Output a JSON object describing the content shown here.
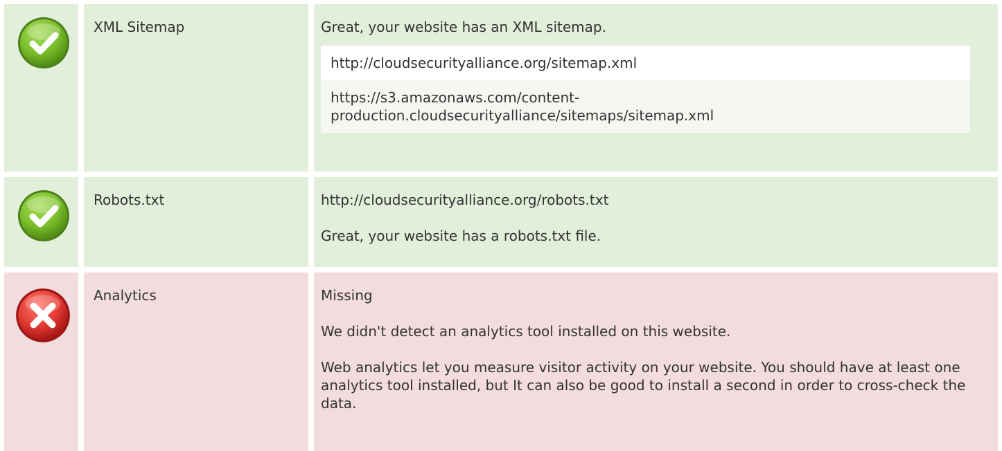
{
  "rows": [
    {
      "status": "pass",
      "icon": "check-icon",
      "label": "XML Sitemap",
      "message": "Great, your website has an XML sitemap.",
      "urls": [
        "http://cloudsecurityalliance.org/sitemap.xml",
        "https://s3.amazonaws.com/content-production.cloudsecurityalliance/sitemaps/sitemap.xml"
      ]
    },
    {
      "status": "pass",
      "icon": "check-icon",
      "label": "Robots.txt",
      "url": "http://cloudsecurityalliance.org/robots.txt",
      "message": "Great, your website has a robots.txt file."
    },
    {
      "status": "fail",
      "icon": "cross-icon",
      "label": "Analytics",
      "value": "Missing",
      "message": "We didn't detect an analytics tool installed on this website.",
      "advice": "Web analytics let you measure visitor activity on your website. You should have at least one analytics tool installed, but It can also be good to install a second in order to cross-check the data."
    }
  ],
  "colors": {
    "pass_bg": "#e2efda",
    "fail_bg": "#f2dcdd",
    "check_green": "#76bc28",
    "cross_red": "#e0383a",
    "text": "#333333"
  }
}
